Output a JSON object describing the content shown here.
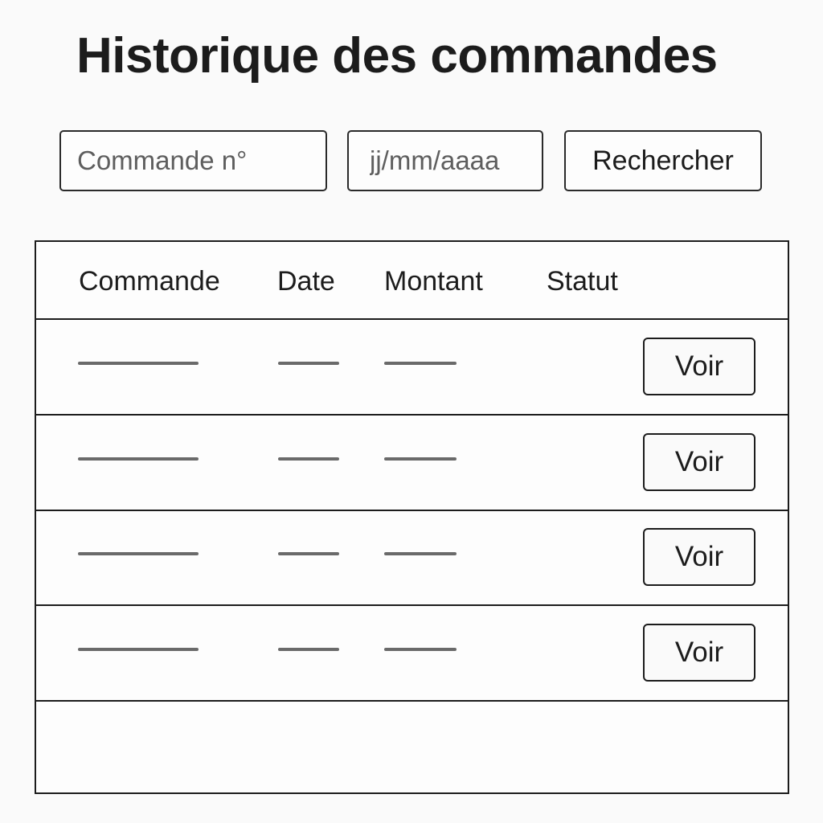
{
  "page": {
    "title": "Historique des commandes"
  },
  "search": {
    "order_placeholder": "Commande n°",
    "date_placeholder": "jj/mm/aaaa",
    "button_label": "Rechercher"
  },
  "table": {
    "columns": [
      "Commande",
      "Date",
      "Montant",
      "Statut"
    ],
    "rows": [
      {
        "action_label": "Voir"
      },
      {
        "action_label": "Voir"
      },
      {
        "action_label": "Voir"
      },
      {
        "action_label": "Voir"
      }
    ]
  }
}
